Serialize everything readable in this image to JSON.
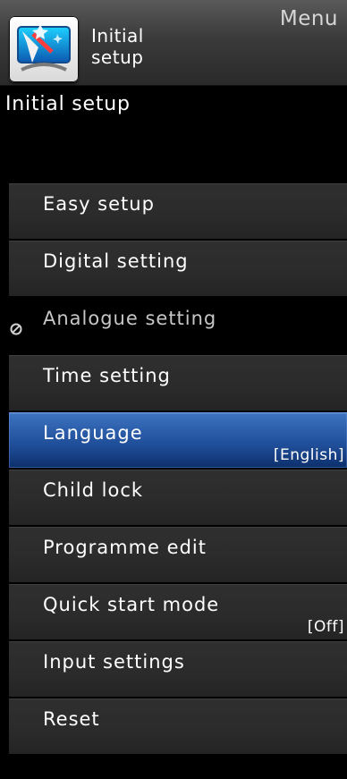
{
  "header": {
    "app_label_line1": "Initial",
    "app_label_line2": "setup",
    "menu_label": "Menu",
    "icon": "initial-setup-icon"
  },
  "page": {
    "title": "Initial setup"
  },
  "menu": {
    "items": [
      {
        "label": "Easy setup",
        "value": "",
        "state": "normal"
      },
      {
        "label": "Digital setting",
        "value": "",
        "state": "normal"
      },
      {
        "label": "Analogue setting",
        "value": "",
        "state": "disabled",
        "icon": "not-available-icon"
      },
      {
        "label": "Time setting",
        "value": "",
        "state": "normal"
      },
      {
        "label": "Language",
        "value": "[English]",
        "state": "selected"
      },
      {
        "label": "Child lock",
        "value": "",
        "state": "normal"
      },
      {
        "label": "Programme edit",
        "value": "",
        "state": "normal"
      },
      {
        "label": "Quick start mode",
        "value": "[Off]",
        "state": "normal"
      },
      {
        "label": "Input settings",
        "value": "",
        "state": "normal"
      },
      {
        "label": "Reset",
        "value": "",
        "state": "normal"
      }
    ]
  },
  "colors": {
    "background": "#000000",
    "item": "#2b2b2b",
    "selected": "#2a5ca8",
    "text": "#ffffff",
    "disabled_text": "#c6c6c6"
  }
}
